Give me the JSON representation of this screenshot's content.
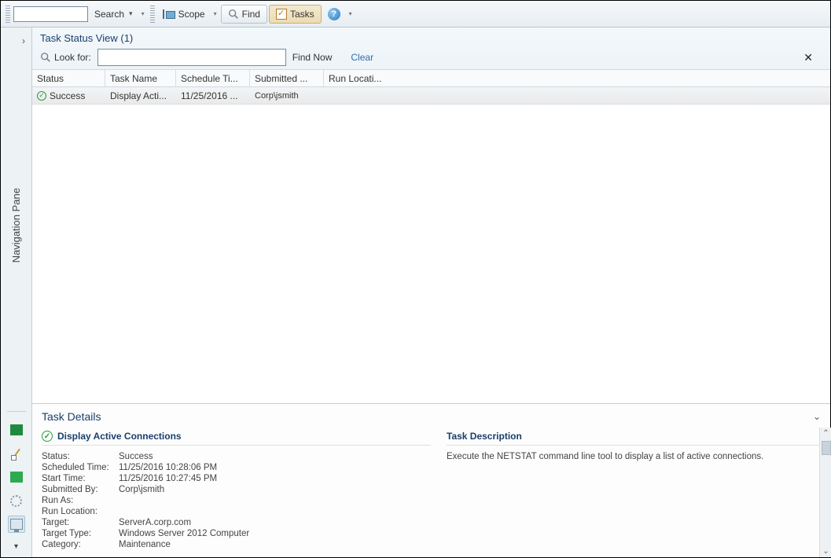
{
  "toolbar": {
    "search_label": "Search",
    "search_value": "",
    "scope_label": "Scope",
    "find_label": "Find",
    "tasks_label": "Tasks"
  },
  "nav": {
    "pane_label": "Navigation Pane"
  },
  "view": {
    "title": "Task Status View (1)",
    "lookfor_label": "Look for:",
    "lookfor_value": "",
    "findnow_label": "Find Now",
    "clear_label": "Clear"
  },
  "grid": {
    "headers": {
      "status": "Status",
      "name": "Task Name",
      "sched": "Schedule Ti...",
      "sub": "Submitted ...",
      "loc": "Run Locati..."
    },
    "rows": [
      {
        "status": "Success",
        "name": "Display Acti...",
        "sched": "11/25/2016 ...",
        "sub": "Corp\\jsmith",
        "loc": ""
      }
    ]
  },
  "details": {
    "header": "Task Details",
    "task_title": "Display Active Connections",
    "labels": {
      "status": "Status:",
      "scheduled": "Scheduled Time:",
      "start": "Start Time:",
      "submitted": "Submitted By:",
      "runas": "Run As:",
      "runloc": "Run Location:",
      "target": "Target:",
      "target_type": "Target Type:",
      "category": "Category:"
    },
    "values": {
      "status": "Success",
      "scheduled": "11/25/2016 10:28:06 PM",
      "start": "11/25/2016 10:27:45 PM",
      "submitted": "Corp\\jsmith",
      "runas": "",
      "runloc": "",
      "target": "ServerA.corp.com",
      "target_type": "Windows Server 2012 Computer",
      "category": "Maintenance"
    },
    "desc_title": "Task Description",
    "desc_text": "Execute the NETSTAT command line tool to display a list of active connections."
  }
}
